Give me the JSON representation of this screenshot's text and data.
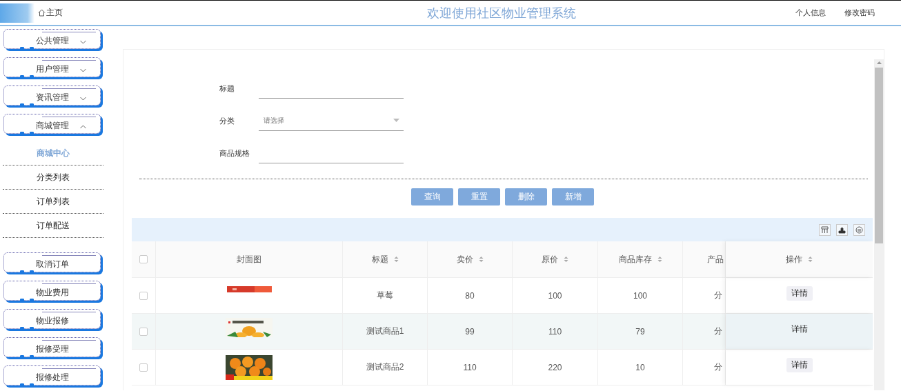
{
  "header": {
    "home": "主页",
    "title": "欢迎使用社区物业管理系统",
    "links": [
      "个人信息",
      "修改密码"
    ]
  },
  "sidebar": {
    "items": [
      {
        "kind": "menu",
        "label": "公共管理",
        "expanded": false
      },
      {
        "kind": "menu",
        "label": "用户管理",
        "expanded": false
      },
      {
        "kind": "menu",
        "label": "资讯管理",
        "expanded": false
      },
      {
        "kind": "menu",
        "label": "商城管理",
        "expanded": true,
        "children": [
          {
            "label": "商城中心",
            "selected": true
          },
          {
            "label": "分类列表",
            "selected": false
          },
          {
            "label": "订单列表",
            "selected": false
          },
          {
            "label": "订单配送",
            "selected": false
          }
        ]
      },
      {
        "kind": "link",
        "label": "取消订单"
      },
      {
        "kind": "link",
        "label": "物业费用"
      },
      {
        "kind": "link",
        "label": "物业报修"
      },
      {
        "kind": "link",
        "label": "报修受理"
      },
      {
        "kind": "link",
        "label": "报修处理"
      }
    ]
  },
  "search": {
    "fields": [
      {
        "kind": "text",
        "label": "标题"
      },
      {
        "kind": "select",
        "label": "分类",
        "placeholder": "请选择"
      },
      {
        "kind": "text",
        "label": "商品规格"
      }
    ],
    "buttons": [
      "查询",
      "重置",
      "删除",
      "新增"
    ]
  },
  "table": {
    "all_checked": false,
    "columns": [
      {
        "label": "封面图",
        "sortable": false
      },
      {
        "label": "标题",
        "sortable": true
      },
      {
        "label": "卖价",
        "sortable": true
      },
      {
        "label": "原价",
        "sortable": true
      },
      {
        "label": "商品库存",
        "sortable": true
      },
      {
        "label": "产品",
        "sortable": false
      },
      {
        "label": "操作",
        "sortable": true
      }
    ],
    "rows": [
      {
        "checked": false,
        "hover": false,
        "cells": [
          {
            "kind": "picture"
          },
          "草莓",
          "80",
          "100",
          "100",
          "分",
          "详情"
        ]
      },
      {
        "checked": false,
        "hover": true,
        "cells": [
          {
            "kind": "picture"
          },
          "测试商品1",
          "99",
          "110",
          "79",
          "分",
          "详情"
        ]
      },
      {
        "checked": false,
        "hover": false,
        "cells": [
          {
            "kind": "picture"
          },
          "测试商品2",
          "110",
          "220",
          "10",
          "分",
          "详情"
        ]
      }
    ]
  }
}
